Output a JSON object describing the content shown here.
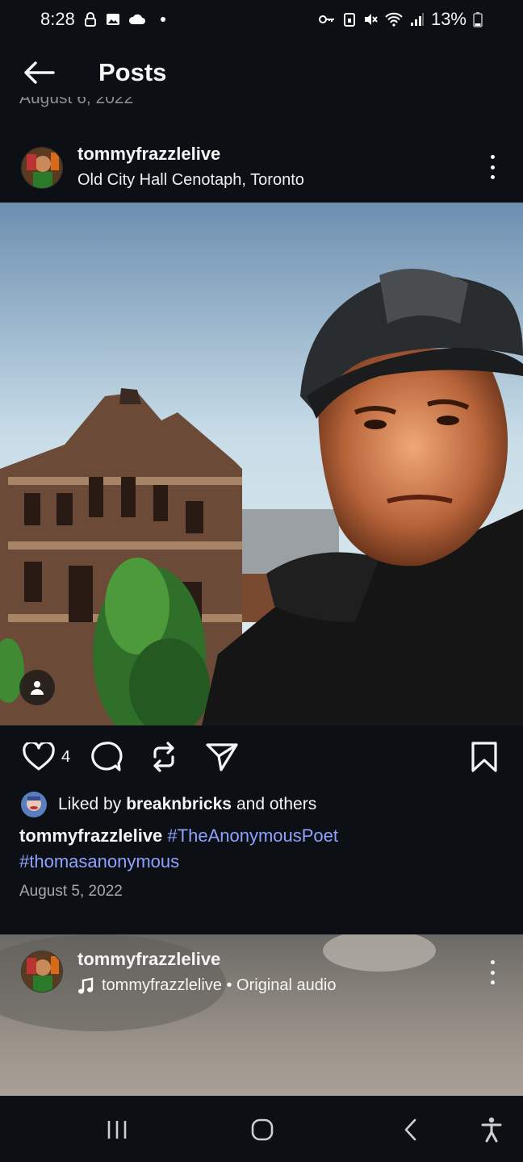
{
  "status": {
    "time": "8:28",
    "battery": "13%",
    "icons": [
      "lock-icon",
      "image-icon",
      "cloud-icon",
      "dot-icon",
      "key-icon",
      "battery-saver-icon",
      "mute-icon",
      "wifi-icon",
      "signal-icon",
      "battery-icon"
    ]
  },
  "header": {
    "title": "Posts",
    "back_icon": "arrow-left-icon"
  },
  "previous_post": {
    "date": "August 6, 2022"
  },
  "post": {
    "username": "tommyfrazzlelive",
    "location": "Old City Hall Cenotaph, Toronto",
    "like_count": "4",
    "liked_by_prefix": "Liked by",
    "liked_by_user": "breaknbricks",
    "liked_by_suffix": "and others",
    "caption_user": "tommyfrazzlelive",
    "hashtag_1": "#TheAnonymousPoet",
    "hashtag_2": "#thomasanonymous",
    "date": "August 5, 2022"
  },
  "next_post": {
    "username": "tommyfrazzlelive",
    "audio": "tommyfrazzlelive • Original audio"
  },
  "colors": {
    "background": "#0c1014",
    "hashtag": "#8ea2ff",
    "muted": "#a8a8a8"
  }
}
